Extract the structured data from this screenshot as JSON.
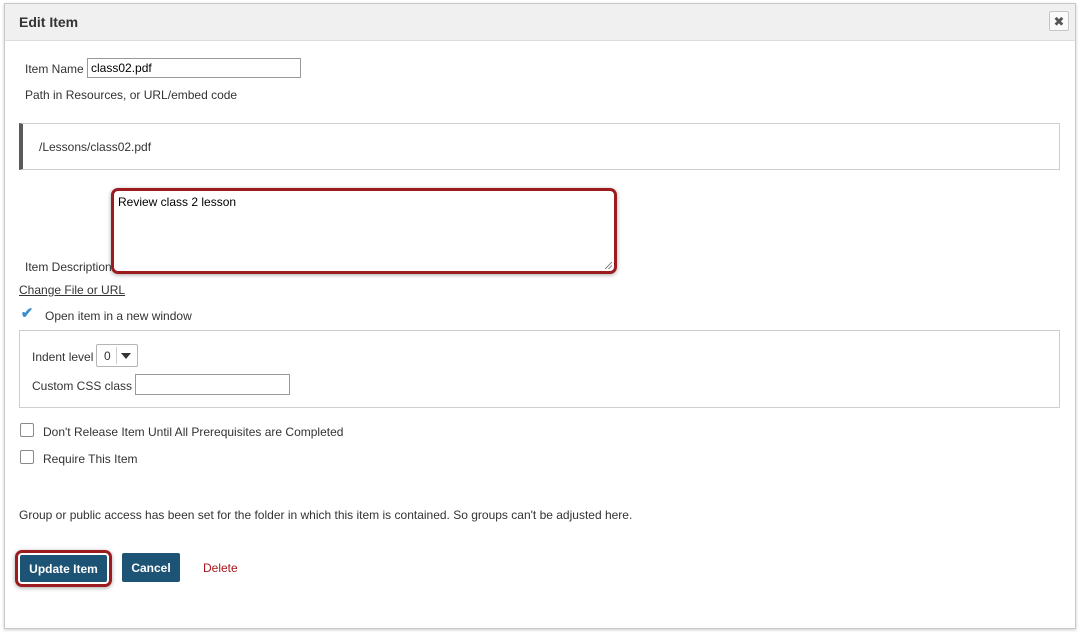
{
  "dialog": {
    "title": "Edit Item",
    "close_icon": "close-icon",
    "close_glyph": "✖"
  },
  "form": {
    "item_name_label": "Item Name",
    "item_name_value": "class02.pdf",
    "path_label": "Path in Resources, or URL/embed code",
    "path_value": "/Lessons/class02.pdf",
    "description_label": "Item Description",
    "description_value": "Review class 2 lesson",
    "change_file_link": "Change File or URL",
    "open_new_window_label": "Open item in a new window",
    "open_new_window_checked": true,
    "check_glyph": "✔",
    "indent_label": "Indent level",
    "indent_value": "0",
    "css_class_label": "Custom CSS class",
    "css_class_value": "",
    "prereq_label": "Don't Release Item Until All Prerequisites are Completed",
    "prereq_checked": false,
    "require_label": "Require This Item",
    "require_checked": false,
    "group_note": "Group or public access has been set for the folder in which this item is contained. So groups can't be adjusted here."
  },
  "actions": {
    "update_label": "Update Item",
    "cancel_label": "Cancel",
    "delete_label": "Delete"
  },
  "colors": {
    "primary_button": "#1d5476",
    "highlight_border": "#9b1b1f",
    "delete_link": "#a8171c",
    "checkbox_check": "#3a8fd1"
  }
}
